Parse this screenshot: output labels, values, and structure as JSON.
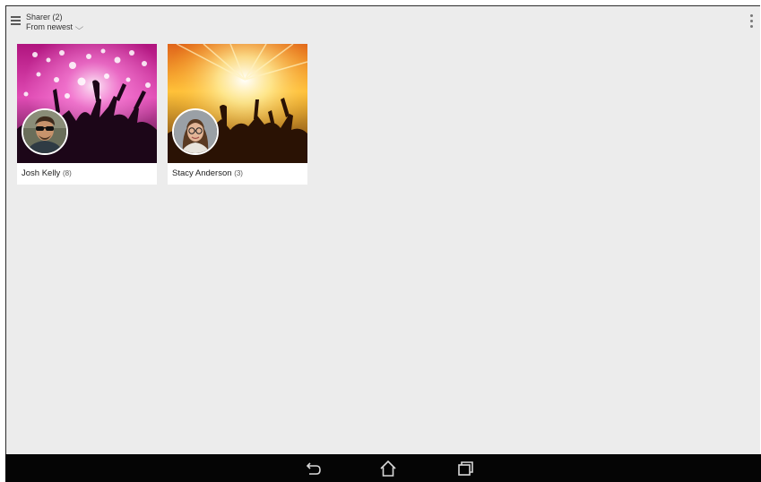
{
  "app": {
    "title": "Sharer (2)",
    "sort_label": "From newest",
    "sort_chevron": "⌵",
    "menu_icon": "hamburger-icon",
    "overflow_icon": "more-vertical-icon"
  },
  "sharers": [
    {
      "name": "Josh Kelly",
      "count": "(8)",
      "cover": "concert-crowd-pink-lights",
      "avatar": "man-with-sunglasses-portrait"
    },
    {
      "name": "Stacy Anderson",
      "count": "(3)",
      "cover": "concert-crowd-golden-lights",
      "avatar": "woman-with-glasses-portrait"
    }
  ],
  "navbar": {
    "back_icon": "back-icon",
    "home_icon": "home-icon",
    "recents_icon": "recent-apps-icon"
  },
  "colors": {
    "background": "#ececec",
    "card": "#ffffff",
    "navbar": "#050505"
  }
}
